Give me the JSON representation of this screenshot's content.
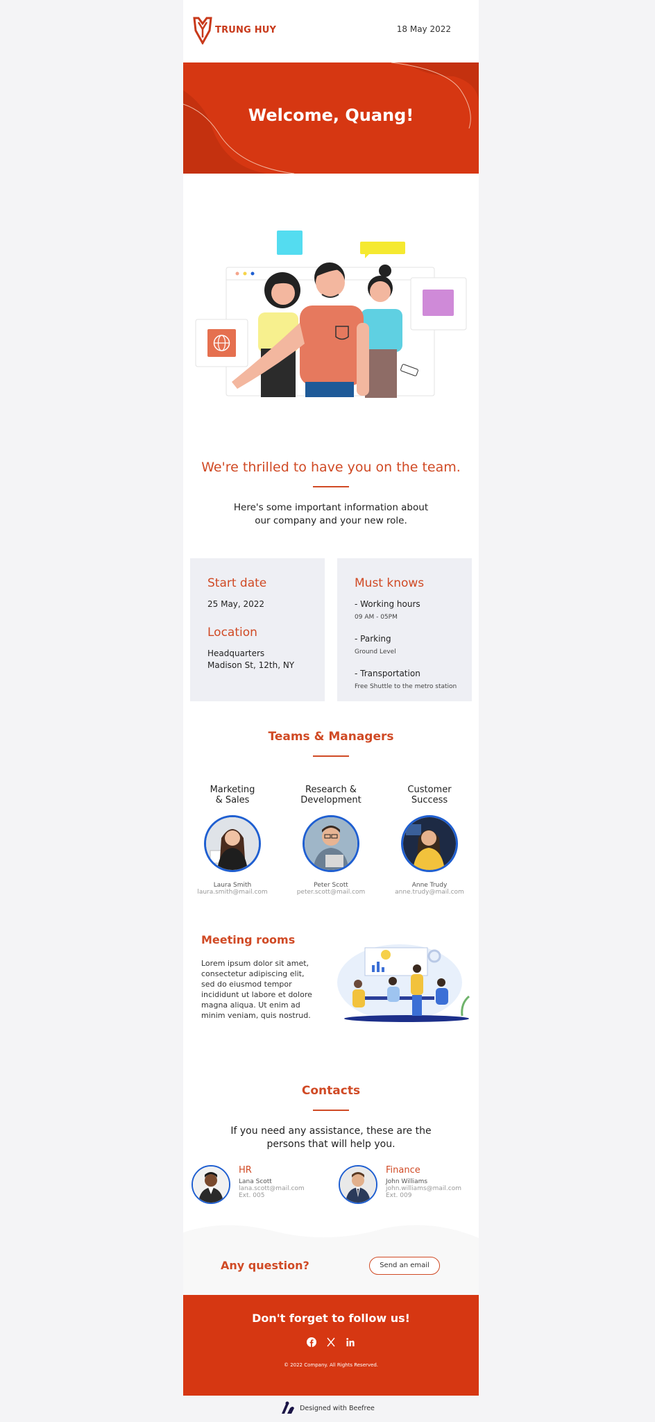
{
  "header": {
    "logo_text": "TRUNG HUY",
    "date": "18 May 2022"
  },
  "hero": {
    "title": "Welcome, Quang!"
  },
  "intro": {
    "headline": "We're thrilled to have you on the team.",
    "text": "Here's some important information about our company and your new role."
  },
  "start_card": {
    "start_title": "Start date",
    "start_value": "25 May, 2022",
    "location_title": "Location",
    "location_line1": "Headquarters",
    "location_line2": "Madison St, 12th, NY"
  },
  "must_card": {
    "title": "Must knows",
    "items": [
      {
        "label": "- Working hours",
        "detail": "09 AM - 05PM"
      },
      {
        "label": "- Parking",
        "detail": "Ground Level"
      },
      {
        "label": "- Transportation",
        "detail": "Free Shuttle to the metro station"
      }
    ]
  },
  "teams": {
    "title": "Teams & Managers",
    "items": [
      {
        "dept_line1": "Marketing",
        "dept_line2": "& Sales",
        "name": "Laura Smith",
        "email": "laura.smith@mail.com"
      },
      {
        "dept_line1": "Research &",
        "dept_line2": "Development",
        "name": "Peter Scott",
        "email": "peter.scott@mail.com"
      },
      {
        "dept_line1": "Customer",
        "dept_line2": "Success",
        "name": "Anne Trudy",
        "email": "anne.trudy@mail.com"
      }
    ]
  },
  "meeting": {
    "title": "Meeting rooms",
    "text": "Lorem ipsum dolor sit amet, consectetur adipiscing elit, sed do eiusmod tempor incididunt ut labore et dolore magna aliqua. Ut enim ad minim veniam, quis nostrud."
  },
  "contacts": {
    "title": "Contacts",
    "text": "If you need any assistance, these are the persons that will help you.",
    "items": [
      {
        "role": "HR",
        "name": "Lana Scott",
        "email": "lana.scott@mail.com",
        "ext": "Ext. 005"
      },
      {
        "role": "Finance",
        "name": "John Williams",
        "email": "john.williams@mail.com",
        "ext": "Ext. 009"
      }
    ]
  },
  "question": {
    "title": "Any question?",
    "button": "Send an email"
  },
  "footer": {
    "title": "Don't forget to follow us!",
    "social_icons": [
      "facebook-icon",
      "x-icon",
      "linkedin-icon"
    ],
    "copyright": "© 2022 Company.  All Rights Reserved."
  },
  "badge": {
    "text": "Designed with Beefree"
  },
  "colors": {
    "brand": "#d63712",
    "accent_text": "#d04a25",
    "card_bg": "#eeeff4",
    "avatar_ring": "#1f5fd1"
  }
}
